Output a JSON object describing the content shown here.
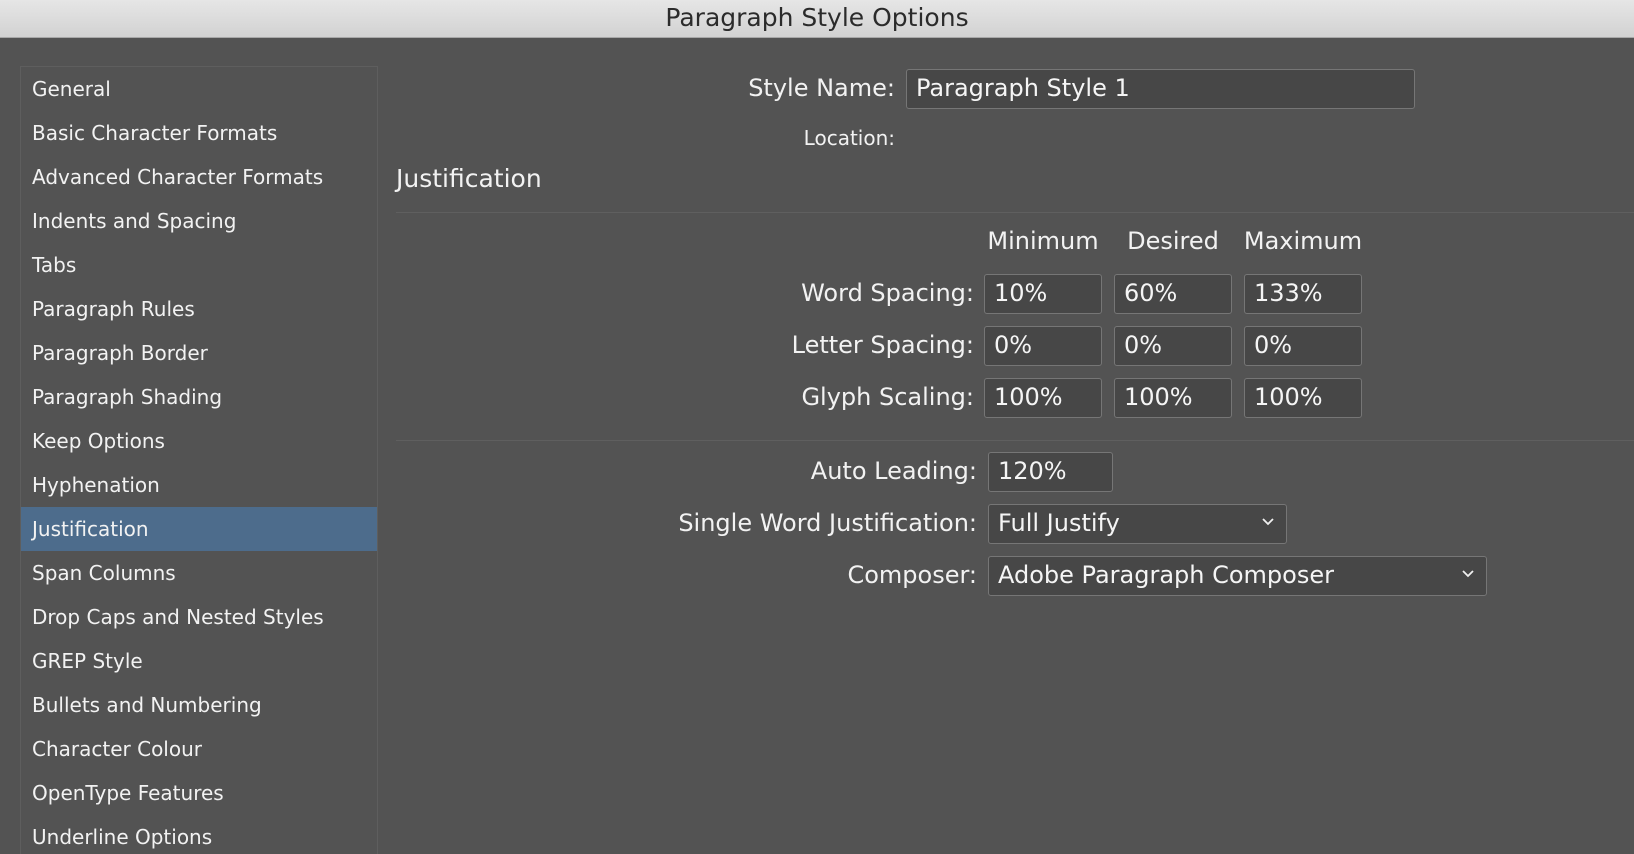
{
  "window": {
    "title": "Paragraph Style Options"
  },
  "sidebar": {
    "items": [
      {
        "label": "General"
      },
      {
        "label": "Basic Character Formats"
      },
      {
        "label": "Advanced Character Formats"
      },
      {
        "label": "Indents and Spacing"
      },
      {
        "label": "Tabs"
      },
      {
        "label": "Paragraph Rules"
      },
      {
        "label": "Paragraph Border"
      },
      {
        "label": "Paragraph Shading"
      },
      {
        "label": "Keep Options"
      },
      {
        "label": "Hyphenation"
      },
      {
        "label": "Justification"
      },
      {
        "label": "Span Columns"
      },
      {
        "label": "Drop Caps and Nested Styles"
      },
      {
        "label": "GREP Style"
      },
      {
        "label": "Bullets and Numbering"
      },
      {
        "label": "Character Colour"
      },
      {
        "label": "OpenType Features"
      },
      {
        "label": "Underline Options"
      }
    ],
    "selected": "Justification",
    "selected_color": "#4d6c8c"
  },
  "header": {
    "style_name_label": "Style Name:",
    "style_name_value": "Paragraph Style 1",
    "location_label": "Location:"
  },
  "justification": {
    "section_title": "Justification",
    "columns": {
      "minimum": "Minimum",
      "desired": "Desired",
      "maximum": "Maximum"
    },
    "word_spacing": {
      "label": "Word Spacing:",
      "minimum": "10%",
      "desired": "60%",
      "maximum": "133%"
    },
    "letter_spacing": {
      "label": "Letter Spacing:",
      "minimum": "0%",
      "desired": "0%",
      "maximum": "0%"
    },
    "glyph_scaling": {
      "label": "Glyph Scaling:",
      "minimum": "100%",
      "desired": "100%",
      "maximum": "100%"
    },
    "auto_leading": {
      "label": "Auto Leading:",
      "value": "120%"
    },
    "single_word": {
      "label": "Single Word Justification:",
      "value": "Full Justify",
      "icon": "chevron-down-icon"
    },
    "composer": {
      "label": "Composer:",
      "value": "Adobe Paragraph Composer",
      "icon": "chevron-down-icon"
    }
  }
}
